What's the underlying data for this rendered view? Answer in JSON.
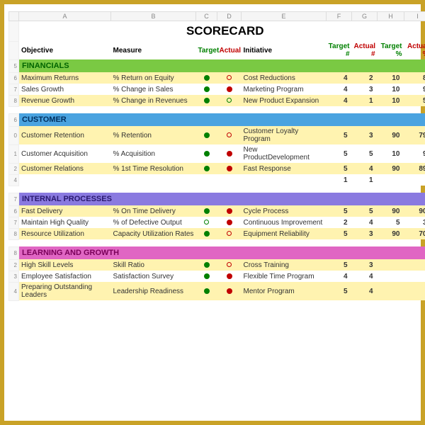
{
  "cols": [
    "",
    "A",
    "B",
    "C",
    "D",
    "E",
    "F",
    "G",
    "H",
    "I"
  ],
  "title": "SCORECARD",
  "headers": {
    "objective": "Objective",
    "measure": "Measure",
    "target": "Target",
    "actual": "Actual",
    "initiative": "Initiative",
    "targetNum": "Target #",
    "actualNum": "Actual #",
    "targetPct": "Target %",
    "actualPct": "Actual %"
  },
  "sections": [
    {
      "name": "FINANCIALS",
      "class": "sec-fin",
      "rows": [
        {
          "rownum": "6",
          "objective": "Maximum Returns",
          "measure": "% Return on Equity",
          "t": "dot-green",
          "a": "ring-red",
          "initiative": "Cost Reductions",
          "tn": "4",
          "an": "2",
          "tp": "10",
          "ap": "8",
          "anColor": "red",
          "apColor": "red"
        },
        {
          "rownum": "7",
          "objective": "Sales Growth",
          "measure": "% Change in Sales",
          "t": "dot-green",
          "a": "dot-red",
          "initiative": "Marketing Program",
          "tn": "4",
          "an": "3",
          "tp": "10",
          "ap": "9",
          "anColor": "black",
          "apColor": "black"
        },
        {
          "rownum": "8",
          "objective": "Revenue Growth",
          "measure": "% Change in Revenues",
          "t": "dot-green",
          "a": "ring-green",
          "initiative": "New Product Expansion",
          "tn": "4",
          "an": "1",
          "tp": "10",
          "ap": "5",
          "anColor": "red",
          "apColor": "red"
        }
      ]
    },
    {
      "name": "CUSTOMER",
      "class": "sec-cus",
      "rows": [
        {
          "rownum": "0",
          "objective": "Customer Retention",
          "measure": "% Retention",
          "t": "dot-green",
          "a": "ring-red",
          "initiative": "Customer Loyalty Program",
          "tn": "5",
          "an": "3",
          "tp": "90",
          "ap": "79",
          "anColor": "red",
          "apColor": "red"
        },
        {
          "rownum": "1",
          "objective": "Customer Acquisition",
          "measure": "% Acquisition",
          "t": "dot-green",
          "a": "dot-red",
          "initiative": "New ProductDevelopment",
          "tn": "5",
          "an": "5",
          "tp": "10",
          "ap": "9",
          "anColor": "black",
          "apColor": "black"
        },
        {
          "rownum": "2",
          "objective": "Customer Relations",
          "measure": "% 1st Time Resolution",
          "t": "dot-green",
          "a": "dot-red",
          "initiative": "Fast Response",
          "tn": "5",
          "an": "4",
          "tp": "90",
          "ap": "89",
          "anColor": "black",
          "apColor": "black"
        }
      ],
      "summary": {
        "rownum": "4",
        "tn": "1",
        "an": "1"
      }
    },
    {
      "name": "INTERNAL PROCESSES",
      "class": "sec-int",
      "rows": [
        {
          "rownum": "6",
          "objective": "Fast Delivery",
          "measure": "% On Time Delivery",
          "t": "dot-green",
          "a": "dot-red",
          "initiative": "Cycle Process",
          "tn": "5",
          "an": "5",
          "tp": "90",
          "ap": "90",
          "anColor": "red",
          "apColor": "red"
        },
        {
          "rownum": "7",
          "objective": "Maintain High Quality",
          "measure": "% of Defective Output",
          "t": "ring-green",
          "a": "dot-red",
          "initiative": "Continuous Improvement",
          "tn": "2",
          "an": "4",
          "tp": "5",
          "ap": "3",
          "anColor": "black",
          "apColor": "black"
        },
        {
          "rownum": "8",
          "objective": "Resource Utilization",
          "measure": "Capacity Utilization Rates",
          "t": "dot-green",
          "a": "ring-red",
          "initiative": "Equipment Reliability",
          "tn": "5",
          "an": "3",
          "tp": "90",
          "ap": "70",
          "anColor": "red",
          "apColor": "red"
        }
      ]
    },
    {
      "name": "LEARNING AND GROWTH",
      "class": "sec-lrn",
      "rows": [
        {
          "rownum": "2",
          "objective": "High Skill Levels",
          "measure": "Skill Ratio",
          "t": "dot-green",
          "a": "ring-red",
          "initiative": "Cross Training",
          "tn": "5",
          "an": "3",
          "tp": "",
          "ap": "",
          "anColor": "black",
          "apColor": "black"
        },
        {
          "rownum": "3",
          "objective": "Employee Satisfaction",
          "measure": "Satisfaction Survey",
          "t": "dot-green",
          "a": "dot-red",
          "initiative": "Flexible Time Program",
          "tn": "4",
          "an": "4",
          "tp": "",
          "ap": "",
          "anColor": "black",
          "apColor": "black"
        },
        {
          "rownum": "4",
          "objective": "Preparing Outstanding Leaders",
          "measure": "Leadership Readiness",
          "t": "dot-green",
          "a": "dot-red",
          "initiative": "Mentor Program",
          "tn": "5",
          "an": "4",
          "tp": "",
          "ap": "",
          "anColor": "black",
          "apColor": "black"
        }
      ]
    }
  ]
}
